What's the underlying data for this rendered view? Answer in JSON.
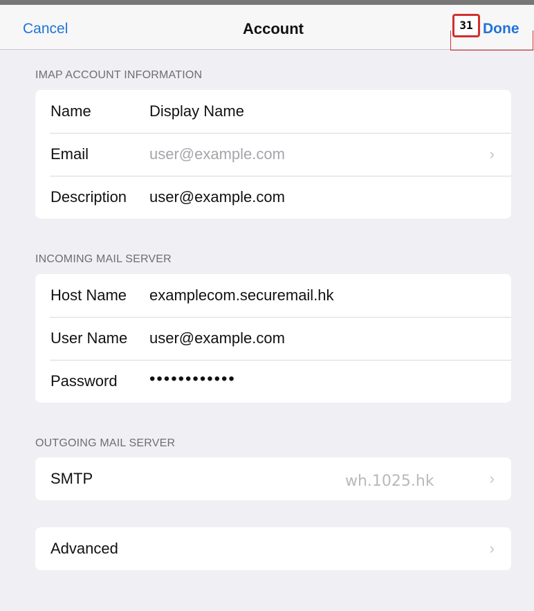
{
  "navbar": {
    "cancel_label": "Cancel",
    "title": "Account",
    "done_label": "Done",
    "step_badge": "31"
  },
  "imap_section": {
    "header": "IMAP ACCOUNT INFORMATION",
    "rows": [
      {
        "label": "Name",
        "value": "Display Name"
      },
      {
        "label": "Email",
        "value": "user@example.com"
      },
      {
        "label": "Description",
        "value": "user@example.com"
      }
    ]
  },
  "incoming_section": {
    "header": "INCOMING MAIL SERVER",
    "rows": [
      {
        "label": "Host Name",
        "value": "examplecom.securemail.hk"
      },
      {
        "label": "User Name",
        "value": "user@example.com"
      },
      {
        "label": "Password",
        "value": "••••••••••••"
      }
    ]
  },
  "outgoing_section": {
    "header": "OUTGOING MAIL SERVER",
    "smtp_label": "SMTP",
    "watermark": "wh.1025.hk"
  },
  "advanced_label": "Advanced",
  "icons": {
    "chevron": "›"
  },
  "colors": {
    "accent": "#1f74d6",
    "background": "#efeff4",
    "highlight": "#d22f2f"
  }
}
